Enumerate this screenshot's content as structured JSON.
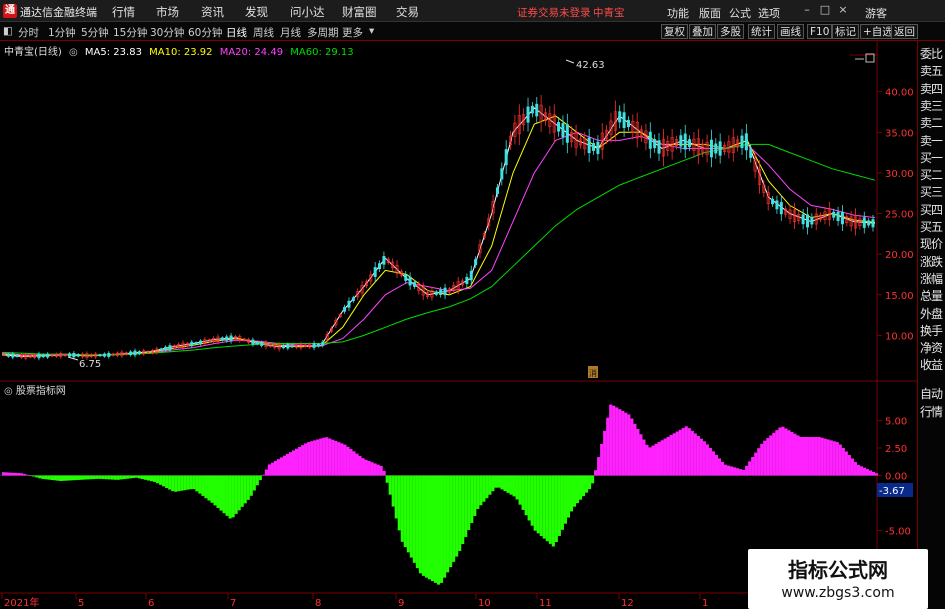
{
  "app": {
    "title": "通达信金融终端",
    "logo": "logo-icon"
  },
  "menu": {
    "items": [
      "行情",
      "市场",
      "资讯",
      "发现",
      "问小达",
      "财富圈",
      "交易"
    ]
  },
  "login": {
    "status": "证券交易未登录",
    "stock": "中青宝"
  },
  "right_menu": {
    "items": [
      "功能",
      "版面",
      "公式",
      "选项"
    ],
    "guest": "游客"
  },
  "window_controls": [
    "min-icon",
    "max-icon",
    "close-icon"
  ],
  "period_tabs": [
    "分时",
    "1分钟",
    "5分钟",
    "15分钟",
    "30分钟",
    "60分钟",
    "日线",
    "周线",
    "月线",
    "多周期",
    "更多"
  ],
  "active_period": "日线",
  "toolbar": [
    "复权",
    "叠加",
    "多股",
    "统计",
    "画线",
    "F10",
    "标记",
    "+自选",
    "返回"
  ],
  "legend": {
    "stock": "中青宝(日线)",
    "ma5": "MA5: 23.83",
    "ma10": "MA10: 23.92",
    "ma20": "MA20: 24.49",
    "ma60": "MA60: 29.13"
  },
  "colors": {
    "ma5": "#ffffff",
    "ma10": "#ffff00",
    "ma20": "#ff44ff",
    "ma60": "#00dd00",
    "up": "#ff3030",
    "down": "#40e0e0",
    "positive": "#ff22ff",
    "negative": "#22ff00",
    "axis": "#7a0000"
  },
  "indicator": {
    "title": "股票指标网",
    "current_value": "-3.67"
  },
  "annotations": {
    "high": "42.63",
    "low": "6.75",
    "marker": "消"
  },
  "sidebar": {
    "items": [
      "委比",
      "卖五",
      "卖四",
      "卖三",
      "卖二",
      "卖一",
      "买一",
      "买二",
      "买三",
      "买四",
      "买五",
      "现价",
      "涨跌",
      "涨幅",
      "总量",
      "外盘",
      "换手",
      "净资",
      "收益"
    ],
    "lower_items": [
      "自动",
      "行情"
    ]
  },
  "watermark": {
    "line1": "指标公式网",
    "line2": "www.zbgs3.com"
  },
  "chart_data": [
    {
      "type": "line",
      "title": "中青宝(日线)",
      "y_ticks": [
        10.0,
        15.0,
        20.0,
        25.0,
        30.0,
        35.0,
        40.0
      ],
      "ylim": [
        5.0,
        45.0
      ],
      "x_ticks": [
        "2021年",
        "5",
        "6",
        "7",
        "8",
        "9",
        "10",
        "11",
        "12",
        "1"
      ],
      "series": [
        {
          "name": "MA5",
          "values": [
            7.6,
            7.4,
            7.5,
            7.6,
            7.5,
            7.6,
            7.8,
            8.0,
            8.6,
            9.0,
            9.5,
            9.7,
            9.0,
            8.6,
            8.7,
            8.8,
            13,
            16,
            19.5,
            17,
            15,
            15.5,
            17,
            25,
            35,
            38,
            36,
            34,
            33,
            37,
            35,
            33,
            34,
            33,
            33,
            34,
            27,
            25,
            24,
            25,
            24,
            23.8
          ]
        },
        {
          "name": "MA10",
          "values": [
            7.7,
            7.5,
            7.5,
            7.6,
            7.5,
            7.6,
            7.7,
            7.9,
            8.4,
            8.8,
            9.3,
            9.6,
            9.2,
            8.8,
            8.6,
            8.7,
            11,
            15,
            18,
            17.5,
            15.5,
            15,
            16,
            21,
            30,
            36,
            37,
            35,
            33,
            35,
            35,
            33.5,
            33.5,
            33.5,
            33,
            34,
            29,
            26,
            24.5,
            25,
            24.2,
            23.9
          ]
        },
        {
          "name": "MA20",
          "values": [
            7.8,
            7.6,
            7.6,
            7.6,
            7.6,
            7.6,
            7.7,
            7.8,
            8.2,
            8.5,
            9.0,
            9.4,
            9.3,
            9.0,
            8.8,
            8.7,
            9.6,
            12,
            15,
            16.5,
            16,
            15.5,
            15.8,
            18,
            24,
            30,
            34,
            35,
            34,
            34,
            34.5,
            33.5,
            33,
            33,
            33,
            33.5,
            31,
            28,
            26,
            25.5,
            24.8,
            24.5
          ]
        },
        {
          "name": "MA60",
          "values": [
            7.9,
            7.8,
            7.7,
            7.7,
            7.6,
            7.6,
            7.7,
            7.8,
            8.0,
            8.2,
            8.5,
            8.7,
            8.9,
            9.0,
            9.0,
            9.0,
            9.2,
            10,
            11,
            12,
            12.8,
            13.5,
            14.5,
            16,
            18.5,
            21,
            23.5,
            25.5,
            27,
            28.5,
            29.5,
            30.5,
            31.5,
            32.5,
            33,
            33.5,
            33.5,
            32.5,
            31.5,
            30.5,
            29.8,
            29.1
          ]
        }
      ]
    },
    {
      "type": "bar",
      "title": "股票指标网",
      "y_ticks": [
        -5.0,
        0.0,
        2.5,
        5.0
      ],
      "ylim": [
        -10.5,
        7.5
      ],
      "values": [
        0.3,
        0.2,
        -0.3,
        -0.5,
        -0.4,
        -0.3,
        -0.4,
        -0.2,
        -0.6,
        -1.5,
        -1.2,
        -2.5,
        -4.0,
        -2.0,
        1.0,
        2.0,
        3.0,
        3.5,
        2.8,
        1.5,
        0.8,
        -6.0,
        -9.0,
        -10.0,
        -7.0,
        -3.0,
        -1.0,
        -2.0,
        -5.0,
        -6.5,
        -3.0,
        -1.0,
        6.5,
        5.5,
        2.5,
        3.5,
        4.5,
        3.0,
        1.0,
        0.5,
        3.0,
        4.5,
        3.5,
        3.5,
        3.0,
        1.0,
        0.2
      ]
    }
  ]
}
